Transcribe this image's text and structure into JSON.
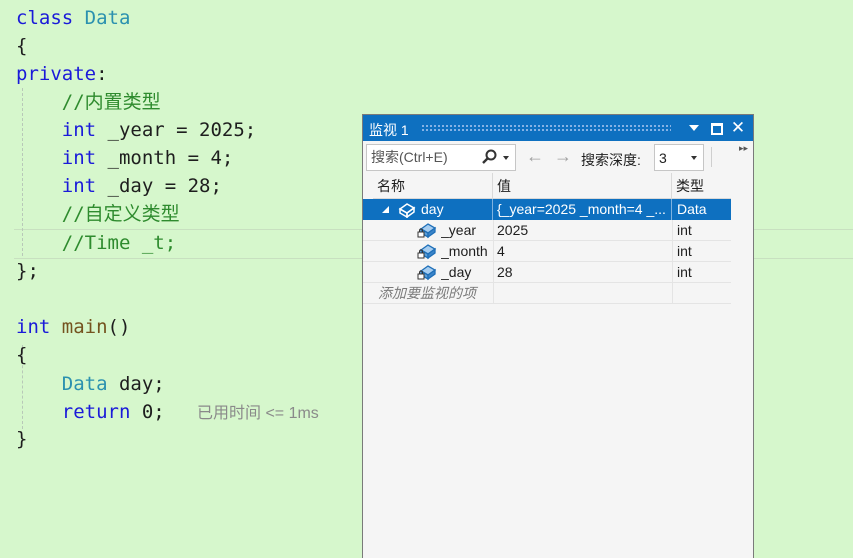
{
  "editor": {
    "lines": [
      {
        "parts": [
          {
            "t": "class ",
            "c": "kw"
          },
          {
            "t": "Data",
            "c": "ty"
          }
        ]
      },
      {
        "parts": [
          {
            "t": "{",
            "c": ""
          }
        ]
      },
      {
        "parts": [
          {
            "t": "private",
            "c": "kw"
          },
          {
            "t": ":",
            "c": ""
          }
        ]
      },
      {
        "parts": [
          {
            "t": "    //内置类型",
            "c": "cm"
          }
        ]
      },
      {
        "parts": [
          {
            "t": "    ",
            "c": ""
          },
          {
            "t": "int",
            "c": "kw"
          },
          {
            "t": " _year = 2025;",
            "c": ""
          }
        ]
      },
      {
        "parts": [
          {
            "t": "    ",
            "c": ""
          },
          {
            "t": "int",
            "c": "kw"
          },
          {
            "t": " _month = 4;",
            "c": ""
          }
        ]
      },
      {
        "parts": [
          {
            "t": "    ",
            "c": ""
          },
          {
            "t": "int",
            "c": "kw"
          },
          {
            "t": " _day = 28;",
            "c": ""
          }
        ]
      },
      {
        "parts": [
          {
            "t": "    //自定义类型",
            "c": "cm"
          }
        ]
      },
      {
        "parts": [
          {
            "t": "    //Time _t;",
            "c": "cm"
          }
        ]
      },
      {
        "parts": [
          {
            "t": "};",
            "c": ""
          }
        ]
      },
      {
        "parts": [
          {
            "t": "",
            "c": ""
          }
        ]
      },
      {
        "parts": [
          {
            "t": "int",
            "c": "kw"
          },
          {
            "t": " ",
            "c": ""
          },
          {
            "t": "main",
            "c": "fn"
          },
          {
            "t": "()",
            "c": ""
          }
        ]
      },
      {
        "parts": [
          {
            "t": "{",
            "c": ""
          }
        ]
      },
      {
        "parts": [
          {
            "t": "    ",
            "c": ""
          },
          {
            "t": "Data",
            "c": "ty"
          },
          {
            "t": " day;",
            "c": ""
          }
        ]
      },
      {
        "parts": [
          {
            "t": "    ",
            "c": ""
          },
          {
            "t": "return",
            "c": "kw"
          },
          {
            "t": " 0;",
            "c": ""
          }
        ]
      },
      {
        "parts": [
          {
            "t": "}",
            "c": ""
          }
        ]
      }
    ],
    "time_hint": "已用时间 <= 1ms"
  },
  "watch": {
    "title": "监视 1",
    "search_placeholder": "搜索(Ctrl+E)",
    "depth_label": "搜索深度:",
    "depth_value": "3",
    "columns": {
      "name": "名称",
      "value": "值",
      "type": "类型"
    },
    "rows": [
      {
        "name": "day",
        "value": "{_year=2025 _month=4 _...",
        "type": "Data"
      },
      {
        "name": "_year",
        "value": "2025",
        "type": "int"
      },
      {
        "name": "_month",
        "value": "4",
        "type": "int"
      },
      {
        "name": "_day",
        "value": "28",
        "type": "int"
      }
    ],
    "add_item_hint": "添加要监视的项"
  },
  "colors": {
    "editor_bg": "#d6f7cc",
    "keyword": "#1a1ad9",
    "type": "#2b91af",
    "comment": "#2e8b2e",
    "title_bar": "#0e70c0"
  }
}
